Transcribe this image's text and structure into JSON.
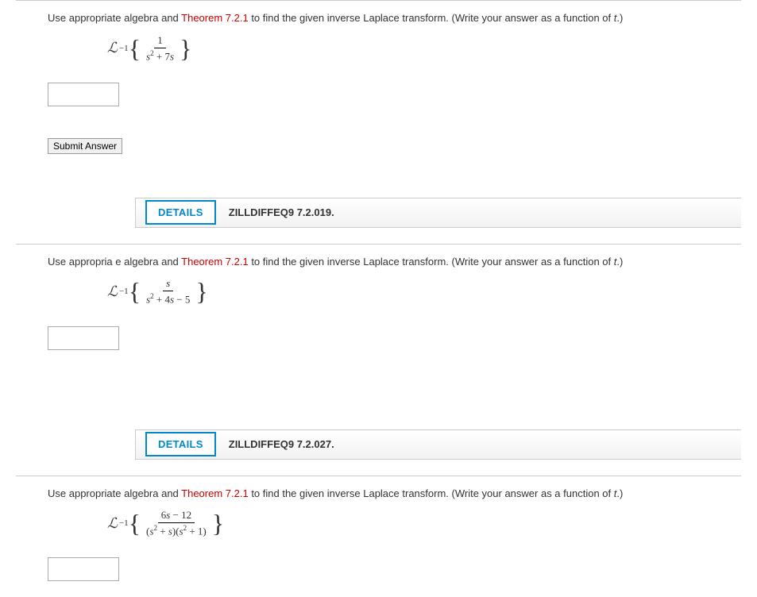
{
  "q1": {
    "prompt_prefix": "Use appropriate algebra and ",
    "theorem": "Theorem 7.2.1",
    "prompt_suffix": " to find the given inverse Laplace transform. (Write your answer as a function of ",
    "var": "t",
    "prompt_end": ".)",
    "laplace": "ℒ",
    "exp": "−1",
    "numerator": "1",
    "denominator_html": "s² + 7s",
    "submit": "Submit Answer"
  },
  "header1": {
    "details": "DETAILS",
    "code": "ZILLDIFFEQ9 7.2.019."
  },
  "q2": {
    "prompt_prefix": "Use appropria e algebra and ",
    "theorem": "Theorem 7.2.1",
    "prompt_suffix": " to find the given inverse Laplace transform. (Write your answer as a function of ",
    "var": "t",
    "prompt_end": ".)",
    "laplace": "ℒ",
    "exp": "−1",
    "numerator": "s",
    "denominator_html": "s² + 4s − 5"
  },
  "header2": {
    "details": "DETAILS",
    "code": "ZILLDIFFEQ9 7.2.027."
  },
  "q3": {
    "prompt_prefix": "Use appropriate algebra and ",
    "theorem": "Theorem 7.2.1",
    "prompt_suffix": " to find the given inverse Laplace transform. (Write your answer as a function of ",
    "var": "t",
    "prompt_end": ".)",
    "laplace": "ℒ",
    "exp": "−1",
    "numerator": "6s − 12",
    "denominator_html": "(s² + s)(s² + 1)"
  }
}
